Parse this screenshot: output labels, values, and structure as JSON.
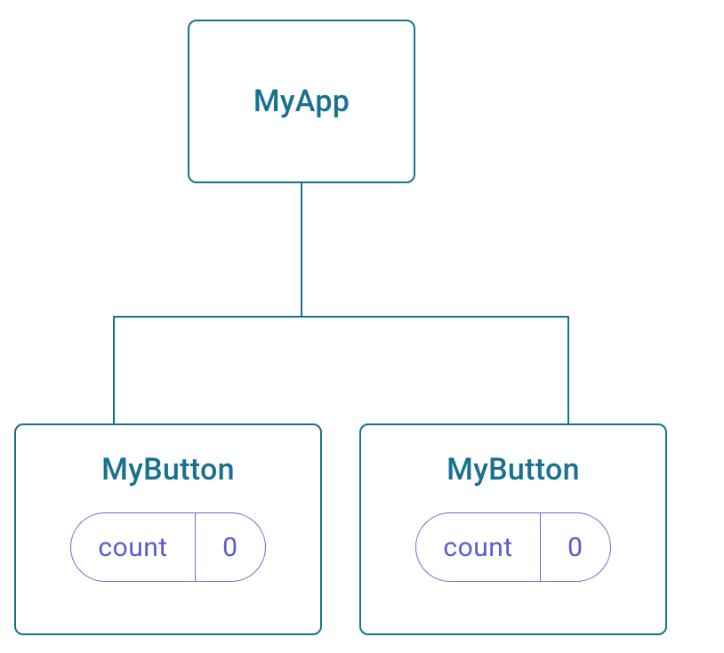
{
  "diagram": {
    "root": {
      "title": "MyApp"
    },
    "children": [
      {
        "title": "MyButton",
        "state_label": "count",
        "state_value": "0"
      },
      {
        "title": "MyButton",
        "state_label": "count",
        "state_value": "0"
      }
    ]
  },
  "colors": {
    "node_border": "#17718f",
    "node_text": "#17718f",
    "pill_border": "#6b6bd8",
    "pill_text": "#5a5ad0"
  }
}
